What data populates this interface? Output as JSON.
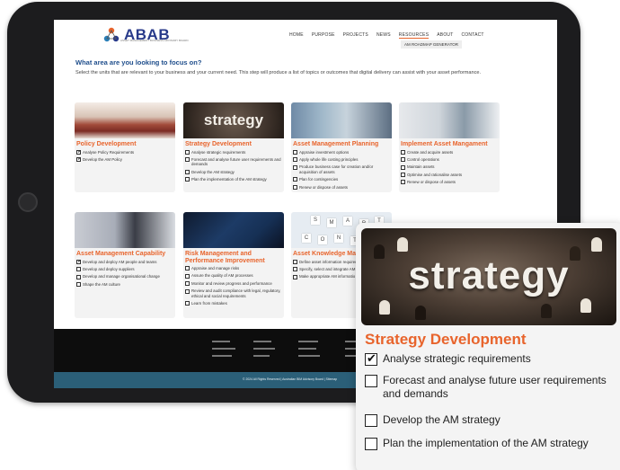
{
  "site": {
    "logo_text": "ABAB",
    "logo_tagline": "ASSET MANAGEMENT BUSINESS ADVISORY BOARD",
    "nav": [
      "HOME",
      "PURPOSE",
      "PROJECTS",
      "NEWS",
      "RESOURCES",
      "ABOUT",
      "CONTACT"
    ],
    "nav_active": "RESOURCES",
    "nav_sub": "AM ROADMAP GENERATOR"
  },
  "intro": {
    "heading": "What area are you looking to focus on?",
    "text": "Select the units that are relevant to your business and your current need. This step will produce a list of topics or outcomes that digital delivery can assist with your asset performance."
  },
  "cards": {
    "policy": {
      "title": "Policy Development",
      "items": [
        {
          "label": "Analyse Policy Requirements",
          "checked": true
        },
        {
          "label": "Develop the AM Policy",
          "checked": true
        }
      ]
    },
    "strategy": {
      "title": "Strategy Development",
      "image_word": "strategy",
      "items": [
        {
          "label": "Analyse strategic requirements",
          "checked": false
        },
        {
          "label": "Forecast and analyse future user requirements and demands",
          "checked": false
        },
        {
          "label": "Develop the AM strategy",
          "checked": false
        },
        {
          "label": "Plan the implementation of the AM strategy",
          "checked": false
        }
      ]
    },
    "planning": {
      "title": "Asset Management Planning",
      "items": [
        {
          "label": "Appraise investment options",
          "checked": false
        },
        {
          "label": "Apply whole life costing principles",
          "checked": false
        },
        {
          "label": "Produce business case for creation and/or acquisition of assets",
          "checked": false
        },
        {
          "label": "Plan for contingencies",
          "checked": false
        },
        {
          "label": "Renew or dispose of assets",
          "checked": false
        }
      ]
    },
    "implement": {
      "title": "Implement Asset Mangament",
      "items": [
        {
          "label": "Create and acquire assets",
          "checked": false
        },
        {
          "label": "Control operations",
          "checked": false
        },
        {
          "label": "Maintain assets",
          "checked": false
        },
        {
          "label": "Optimise and rationalise assets",
          "checked": false
        },
        {
          "label": "Renew or dispose of assets",
          "checked": false
        }
      ]
    },
    "capability": {
      "title": "Asset Management Capability",
      "items": [
        {
          "label": "Develop and deploy AM people and teams",
          "checked": true
        },
        {
          "label": "Develop and deploy suppliers",
          "checked": false
        },
        {
          "label": "Develop and manage organisational change",
          "checked": false
        },
        {
          "label": "Shape the AM culture",
          "checked": false
        }
      ]
    },
    "risk": {
      "title": "Risk Management and Performance Improvement",
      "items": [
        {
          "label": "Appraise and manage risks",
          "checked": false
        },
        {
          "label": "Assure the quality of AM processes",
          "checked": false
        },
        {
          "label": "Monitor and review progress and performance",
          "checked": false
        },
        {
          "label": "Review and audit compliance with legal, regulatory, ethical and social requirements",
          "checked": false
        },
        {
          "label": "Learn from mistakes",
          "checked": false
        }
      ]
    },
    "knowledge": {
      "title": "Asset Knowledge Mana",
      "tiles": [
        "S",
        "M",
        "A",
        "R",
        "T",
        "C",
        "O",
        "N",
        "T",
        "E"
      ],
      "items": [
        {
          "label": "Define asset information requiren",
          "checked": false
        },
        {
          "label": "Specify, select and integrate AM I systems",
          "checked": false
        },
        {
          "label": "Make appropriate AM informatio decision making",
          "checked": false
        }
      ]
    }
  },
  "footer": {
    "copyright": "© 2024 All Rights Reserved | Australian BIM Advisory Board | Sitemap"
  },
  "zoom": {
    "image_word": "strategy",
    "title": "Strategy Development",
    "items": [
      {
        "label": "Analyse strategic requirements",
        "checked": true
      },
      {
        "label": "Forecast and analyse future user requirements and demands",
        "checked": false
      },
      {
        "label": "Develop the AM strategy",
        "checked": false
      },
      {
        "label": "Plan the implementation of the AM strategy",
        "checked": false
      }
    ]
  },
  "colors": {
    "accent": "#e8642c",
    "heading_blue": "#1f4e8c",
    "logo_blue": "#283a8a",
    "footer_bar": "#2b5f78"
  }
}
